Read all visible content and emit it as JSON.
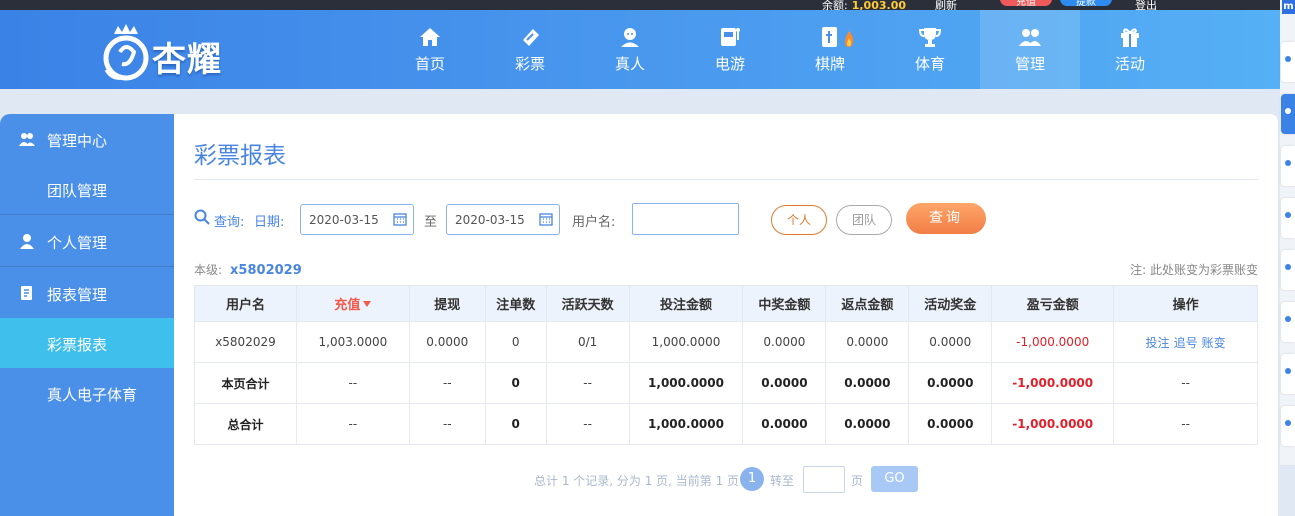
{
  "topbar": {
    "balance_label": "余额:",
    "balance_value": "1,003.00",
    "refresh_label": "刷新",
    "recharge_label": "充值",
    "withdraw_label": "提款",
    "logout_label": "登出"
  },
  "header": {
    "logo_text": "杏耀",
    "nav": [
      {
        "label": "首页",
        "icon": "home-icon"
      },
      {
        "label": "彩票",
        "icon": "lottery-icon"
      },
      {
        "label": "真人",
        "icon": "live-dealer-icon"
      },
      {
        "label": "电游",
        "icon": "slot-icon"
      },
      {
        "label": "棋牌",
        "icon": "mahjong-icon"
      },
      {
        "label": "体育",
        "icon": "trophy-icon"
      },
      {
        "label": "管理",
        "icon": "users-icon"
      },
      {
        "label": "活动",
        "icon": "gift-icon"
      }
    ],
    "active_nav": "管理"
  },
  "sidebar": {
    "items": [
      {
        "label": "管理中心",
        "icon": "users-icon"
      },
      {
        "label": "团队管理"
      },
      {
        "label": "个人管理",
        "icon": "user-icon"
      },
      {
        "label": "报表管理",
        "icon": "report-icon"
      },
      {
        "label": "彩票报表"
      },
      {
        "label": "真人电子体育"
      }
    ]
  },
  "page": {
    "title": "彩票报表",
    "filter": {
      "query_label": "查询:",
      "date_label": "日期:",
      "date_from": "2020-03-15",
      "to_label": "至",
      "date_to": "2020-03-15",
      "username_label": "用户名:",
      "username_value": "",
      "personal_label": "个人",
      "team_label": "团队",
      "query_button": "查询"
    },
    "level_label": "本级:",
    "level_account": "x5802029",
    "note": "注: 此处账变为彩票账变"
  },
  "table": {
    "headers": [
      "用户名",
      "充值",
      "提现",
      "注单数",
      "活跃天数",
      "投注金额",
      "中奖金额",
      "返点金额",
      "活动奖金",
      "盈亏金额",
      "操作"
    ],
    "row": {
      "username": "x5802029",
      "recharge": "1,003.0000",
      "withdraw": "0.0000",
      "orders": "0",
      "active_days": "0/1",
      "bet": "1,000.0000",
      "win": "0.0000",
      "rebate": "0.0000",
      "bonus": "0.0000",
      "profit": "-1,000.0000",
      "ops": [
        "投注",
        "追号",
        "账变"
      ]
    },
    "page_total": {
      "label": "本页合计",
      "recharge": "--",
      "withdraw": "--",
      "orders": "0",
      "active_days": "--",
      "bet": "1,000.0000",
      "win": "0.0000",
      "rebate": "0.0000",
      "bonus": "0.0000",
      "profit": "-1,000.0000",
      "ops": "--"
    },
    "grand_total": {
      "label": "总合计",
      "recharge": "--",
      "withdraw": "--",
      "orders": "0",
      "active_days": "--",
      "bet": "1,000.0000",
      "win": "0.0000",
      "rebate": "0.0000",
      "bonus": "0.0000",
      "profit": "-1,000.0000",
      "ops": "--"
    }
  },
  "pager": {
    "summary": "总计 1 个记录, 分为 1 页, 当前第 1 页",
    "current": "1",
    "goto_label": "转至",
    "page_unit": "页",
    "go_label": "GO"
  },
  "right_panel": {
    "logo": "m"
  },
  "colors": {
    "accent": "#4a86e0",
    "sidebar_active": "#3fc0ec",
    "negative": "#e0202a",
    "query_button": "#f17d45"
  }
}
